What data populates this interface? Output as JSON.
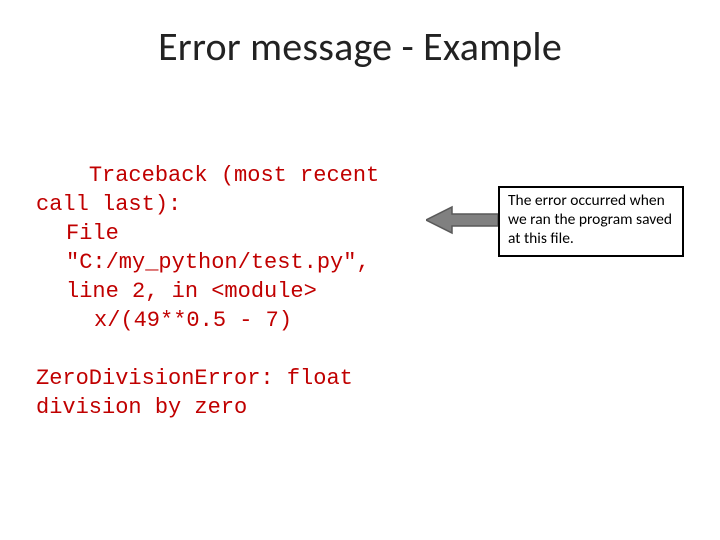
{
  "title": "Error message - Example",
  "traceback": {
    "line1": "Traceback (most recent call last):",
    "line2a": "File \"C:/my_python/test.py\", line 2, in <module>",
    "line3": "x/(49**0.5 - 7)",
    "line4": "ZeroDivisionError: float division by zero"
  },
  "callout": {
    "text": "The error occurred when we ran the program saved at this file."
  }
}
